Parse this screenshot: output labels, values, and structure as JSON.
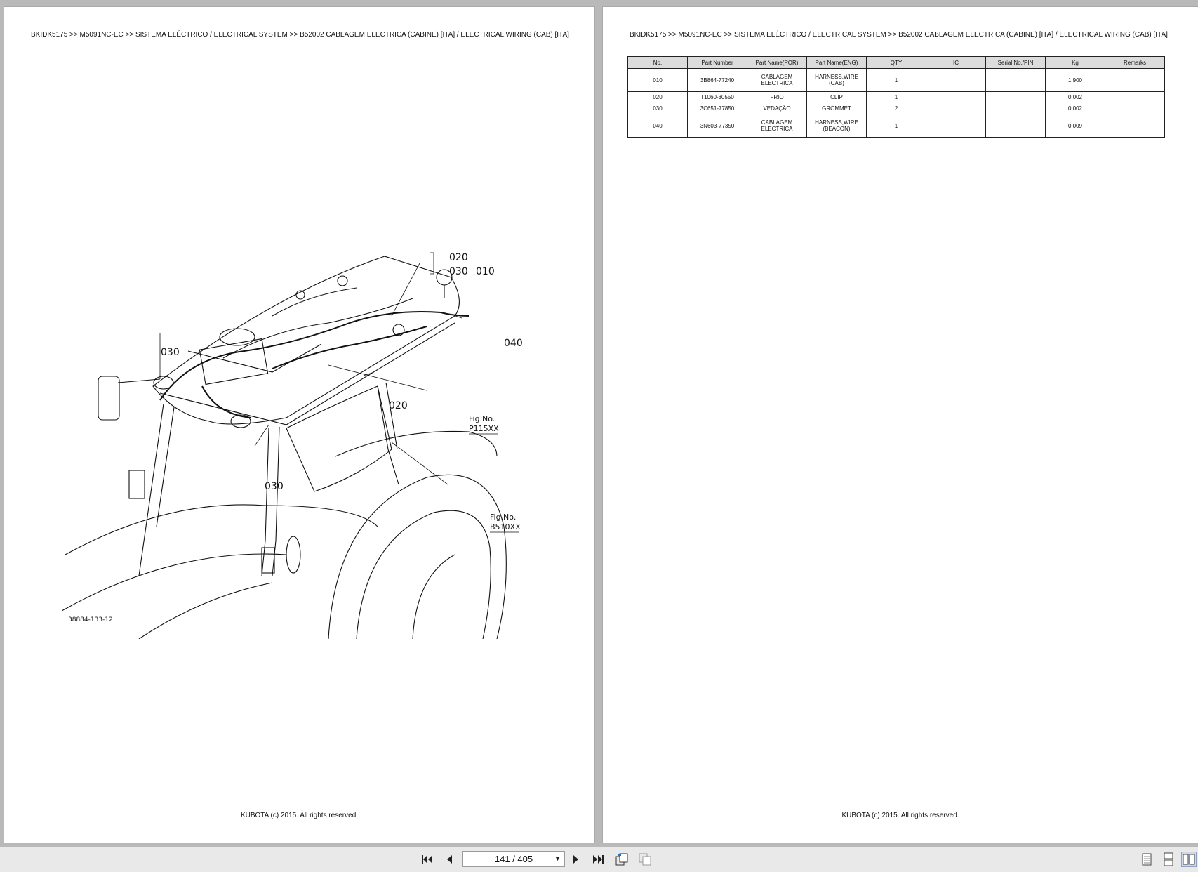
{
  "viewer": {
    "page_indicator": "141 / 405",
    "buttons": [
      "first-page",
      "previous-page",
      "next-page",
      "last-page",
      "continuous-scroll",
      "two-page-layout"
    ]
  },
  "left_page": {
    "breadcrumb": "BKIDK5175 >> M5091NC-EC >> SISTEMA ELÉCTRICO / ELECTRICAL SYSTEM >> B52002   CABLAGEM ELECTRICA (CABINE) [ITA] / ELECTRICAL WIRING (CAB) [ITA]",
    "footer": "KUBOTA (c) 2015. All rights reserved.",
    "diagram": {
      "drawing_id": "38884-133-12",
      "callouts": [
        "020",
        "030",
        "010",
        "040",
        "030",
        "020",
        "030"
      ],
      "fig_label": "Fig.No.",
      "fig_refs": [
        "P115XX",
        "B510XX"
      ]
    }
  },
  "right_page": {
    "breadcrumb": "BKIDK5175 >> M5091NC-EC >> SISTEMA ELÉCTRICO / ELECTRICAL SYSTEM >> B52002   CABLAGEM ELECTRICA (CABINE) [ITA] / ELECTRICAL WIRING (CAB) [ITA]",
    "footer": "KUBOTA (c) 2015. All rights reserved.",
    "table": {
      "headers": [
        "No.",
        "Part Number",
        "Part Name(POR)",
        "Part Name(ENG)",
        "QTY",
        "IC",
        "Serial No./PIN",
        "Kg",
        "Remarks"
      ],
      "rows": [
        {
          "no": "010",
          "part_number": "3B864-77240",
          "name_por": "CABLAGEM ELECTRICA",
          "name_eng": "HARNESS,WIRE (CAB)",
          "qty": "1",
          "ic": "",
          "serial": "",
          "kg": "1.900",
          "remarks": ""
        },
        {
          "no": "020",
          "part_number": "T1060-30550",
          "name_por": "FRIO",
          "name_eng": "CLIP",
          "qty": "1",
          "ic": "",
          "serial": "",
          "kg": "0.002",
          "remarks": ""
        },
        {
          "no": "030",
          "part_number": "3C651-77850",
          "name_por": "VEDAÇÃO",
          "name_eng": "GROMMET",
          "qty": "2",
          "ic": "",
          "serial": "",
          "kg": "0.002",
          "remarks": ""
        },
        {
          "no": "040",
          "part_number": "3N603-77350",
          "name_por": "CABLAGEM ELECTRICA",
          "name_eng": "HARNESS,WIRE (BEACON)",
          "qty": "1",
          "ic": "",
          "serial": "",
          "kg": "0.009",
          "remarks": ""
        }
      ]
    }
  }
}
